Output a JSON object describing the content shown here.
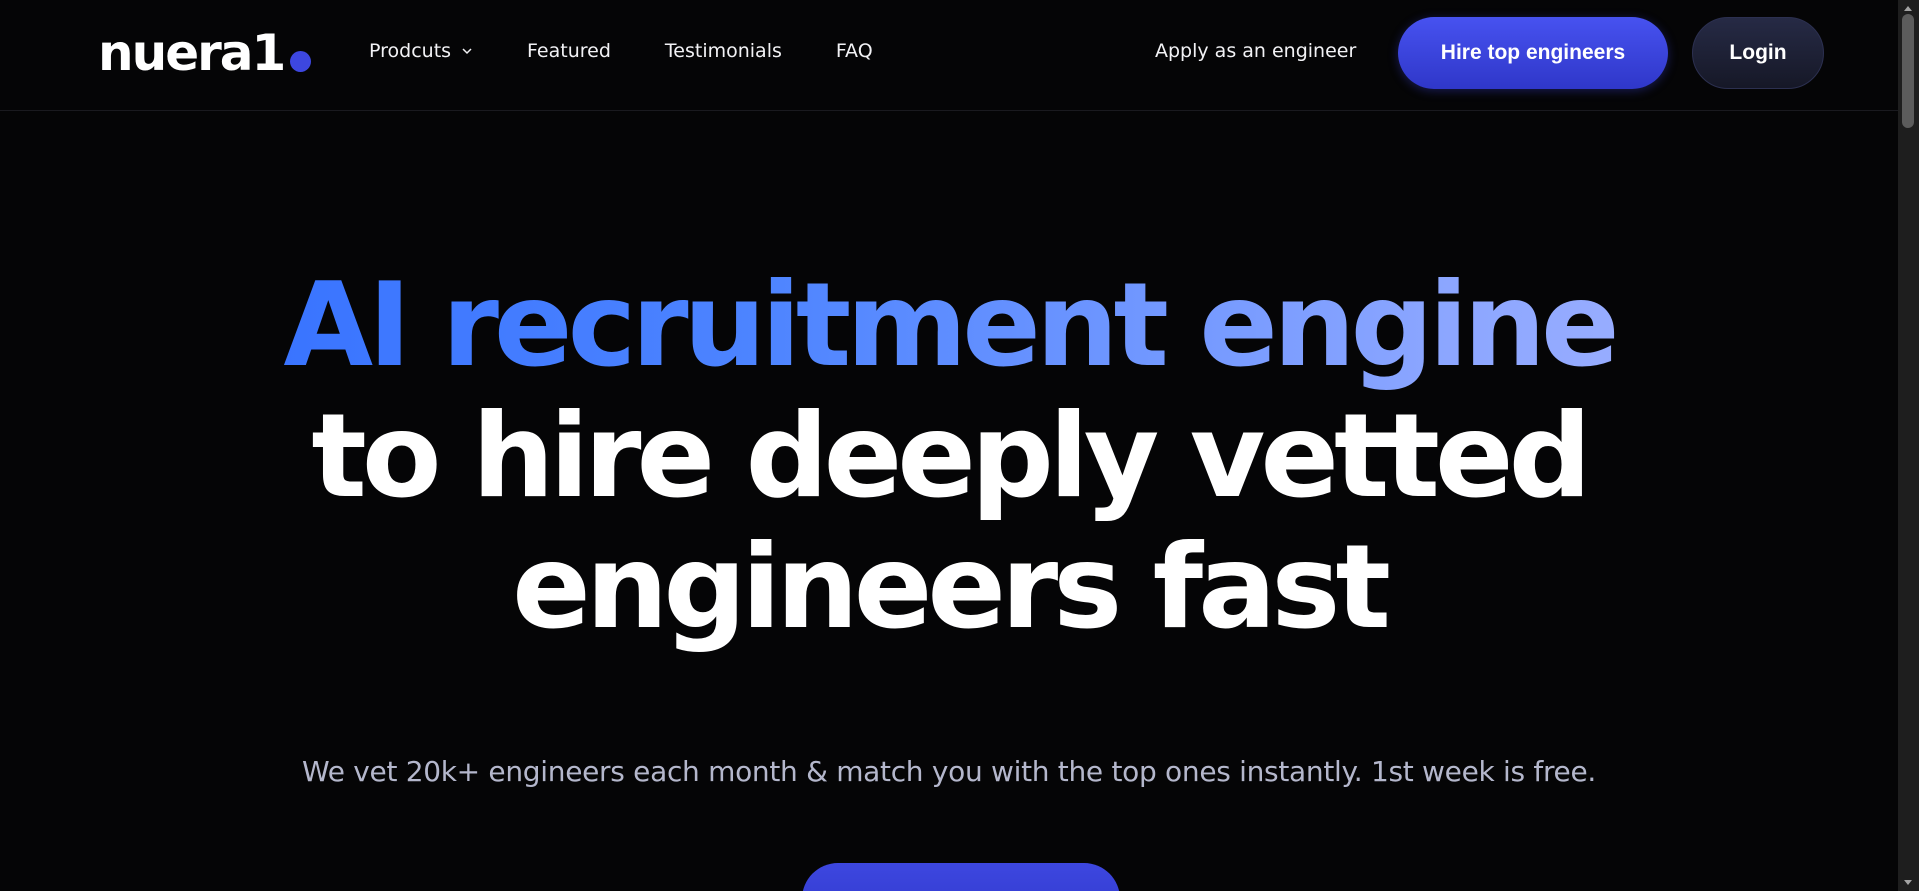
{
  "navbar": {
    "logo_text": "nuera1",
    "links": [
      {
        "label": "Prodcuts",
        "has_dropdown": true
      },
      {
        "label": "Featured"
      },
      {
        "label": "Testimonials"
      },
      {
        "label": "FAQ"
      }
    ],
    "apply_label": "Apply as an engineer",
    "hire_label": "Hire top engineers",
    "login_label": "Login"
  },
  "hero": {
    "headline_accent": "AI recruitment engine",
    "headline_line2": "to hire deeply vetted",
    "headline_line3": "engineers fast",
    "subtitle": "We vet 20k+ engineers each month & match you with the top ones instantly. 1st week is free."
  },
  "colors": {
    "background": "#050506",
    "accent": "#3d47e0",
    "headline_gradient_start": "#2e6bff",
    "headline_gradient_end": "#aab7ff",
    "subtitle": "#b4b7cc"
  },
  "icons": {
    "dropdown": "chevron-down-icon",
    "logo_dot": "logo-dot-icon"
  }
}
